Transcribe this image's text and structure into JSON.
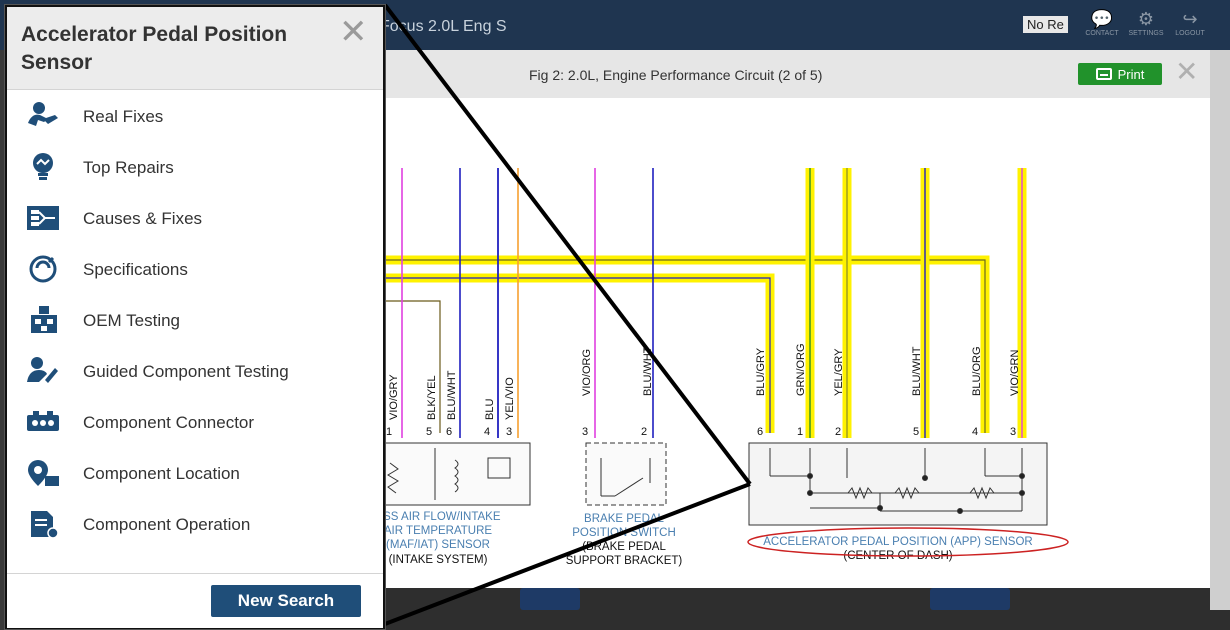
{
  "app": {
    "title": "Focus 2.0L Eng S",
    "no_results": "No Re",
    "buttons": [
      {
        "label": "CONTACT",
        "icon": "chat-bubbles-icon"
      },
      {
        "label": "SETTINGS",
        "icon": "gears-icon"
      },
      {
        "label": "LOGOUT",
        "icon": "logout-icon"
      }
    ]
  },
  "panel": {
    "title": "Accelerator Pedal Position Sensor",
    "menu": [
      {
        "label": "Real Fixes",
        "icon": "real-fixes-icon"
      },
      {
        "label": "Top Repairs",
        "icon": "top-repairs-icon"
      },
      {
        "label": "Causes & Fixes",
        "icon": "causes-fixes-icon"
      },
      {
        "label": "Specifications",
        "icon": "specifications-icon"
      },
      {
        "label": "OEM Testing",
        "icon": "oem-testing-icon"
      },
      {
        "label": "Guided Component Testing",
        "icon": "guided-testing-icon"
      },
      {
        "label": "Component Connector",
        "icon": "connector-icon"
      },
      {
        "label": "Component Location",
        "icon": "location-icon"
      },
      {
        "label": "Component Operation",
        "icon": "operation-icon"
      }
    ],
    "new_search": "New Search"
  },
  "figure": {
    "title": "Fig 2: 2.0L, Engine Performance Circuit (2 of 5)",
    "print_label": "Print",
    "maf": {
      "pins": [
        "1",
        "5",
        "6",
        "4",
        "3"
      ],
      "wires": [
        "VIO/GRY",
        "BLK/YEL",
        "BLU/WHT",
        "BLU",
        "YEL/VIO"
      ],
      "name_lines": [
        "ASS AIR FLOW/INTAKE",
        "AIR TEMPERATURE",
        "(MAF/IAT) SENSOR"
      ],
      "location": "(INTAKE SYSTEM)"
    },
    "brake": {
      "pins": [
        "3",
        "2"
      ],
      "wires": [
        "VIO/ORG",
        "BLU/WHT"
      ],
      "name_lines": [
        "BRAKE PEDAL",
        "POSITION SWITCH"
      ],
      "location_lines": [
        "(BRAKE PEDAL",
        "SUPPORT BRACKET)"
      ]
    },
    "app": {
      "pins": [
        "6",
        "1",
        "2",
        "5",
        "4",
        "3"
      ],
      "wires": [
        "BLU/GRY",
        "GRN/ORG",
        "YEL/GRY",
        "BLU/WHT",
        "BLU/ORG",
        "VIO/GRN"
      ],
      "name": "ACCELERATOR PEDAL POSITION (APP) SENSOR",
      "location": "(CENTER OF DASH)"
    },
    "colors": {
      "highlight": "#fff200",
      "sensor_label": "#4a7fb0",
      "callout": "#cc2222",
      "wire_pink": "#e040e0",
      "wire_blue": "#2020c0"
    }
  }
}
